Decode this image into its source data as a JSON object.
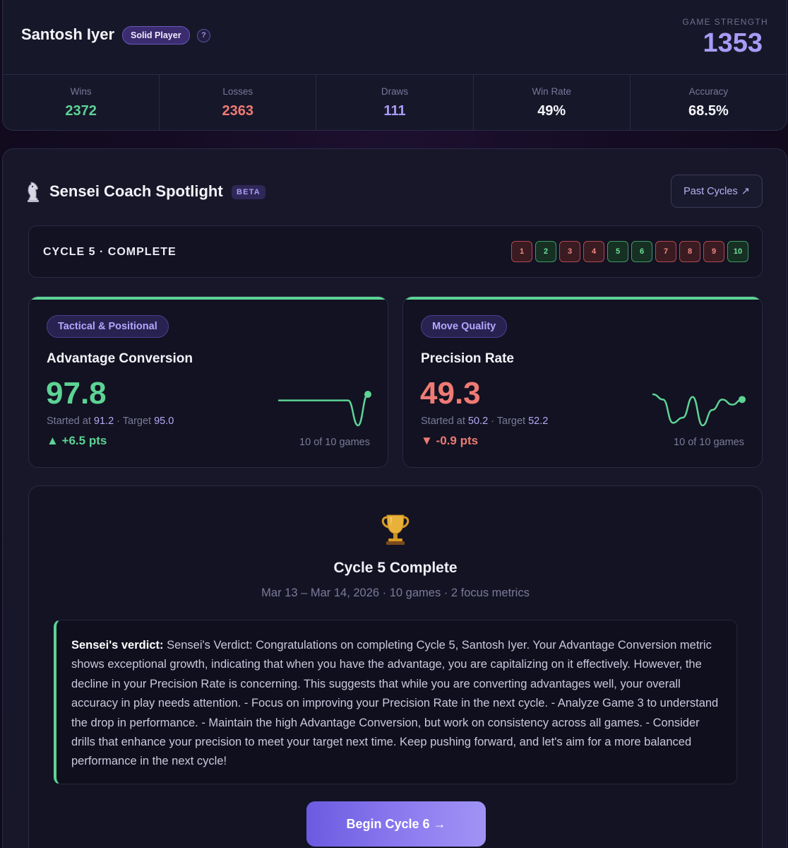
{
  "profile": {
    "name": "Santosh Iyer",
    "tier": "Solid Player",
    "help_glyph": "?",
    "strength_label": "GAME STRENGTH",
    "strength_value": "1353",
    "stats": [
      {
        "label": "Wins",
        "value": "2372",
        "color": "#5dd394"
      },
      {
        "label": "Losses",
        "value": "2363",
        "color": "#ef7b74"
      },
      {
        "label": "Draws",
        "value": "111",
        "color": "#a89bf7"
      },
      {
        "label": "Win Rate",
        "value": "49%",
        "color": "#f5f5fb"
      },
      {
        "label": "Accuracy",
        "value": "68.5%",
        "color": "#f5f5fb"
      }
    ]
  },
  "coach": {
    "title": "Sensei Coach Spotlight",
    "beta": "BETA",
    "past_cycles": "Past Cycles",
    "past_cycles_arrow": "↗",
    "cycle_label": "CYCLE 5 · COMPLETE",
    "games": [
      {
        "n": "1",
        "result": "loss"
      },
      {
        "n": "2",
        "result": "win"
      },
      {
        "n": "3",
        "result": "loss"
      },
      {
        "n": "4",
        "result": "loss"
      },
      {
        "n": "5",
        "result": "win"
      },
      {
        "n": "6",
        "result": "win"
      },
      {
        "n": "7",
        "result": "loss"
      },
      {
        "n": "8",
        "result": "loss"
      },
      {
        "n": "9",
        "result": "loss"
      },
      {
        "n": "10",
        "result": "win"
      }
    ],
    "metrics": [
      {
        "tag": "Tactical & Positional",
        "name": "Advantage Conversion",
        "value": "97.8",
        "value_color": "#5dd394",
        "started_label": "Started at",
        "started": "91.2",
        "target_label": "Target",
        "target": "95.0",
        "delta": "▲ +6.5 pts",
        "delta_color": "#5dd394",
        "games_note": "10 of 10 games",
        "trend": [
          95.5,
          95.5,
          95.5,
          95.5,
          95.5,
          95.5,
          95.5,
          95.5,
          86.0,
          97.8
        ]
      },
      {
        "tag": "Move Quality",
        "name": "Precision Rate",
        "value": "49.3",
        "value_color": "#ef7b74",
        "started_label": "Started at",
        "started": "50.2",
        "target_label": "Target",
        "target": "52.2",
        "delta": "▼ -0.9 pts",
        "delta_color": "#ef7b74",
        "games_note": "10 of 10 games",
        "trend": [
          49.8,
          49.6,
          48.7,
          48.9,
          49.7,
          48.6,
          49.2,
          49.6,
          49.4,
          49.6
        ]
      }
    ],
    "summary": {
      "trophy_icon": "trophy-icon",
      "title": "Cycle 5 Complete",
      "meta": "Mar 13 – Mar 14, 2026 · 10 games · 2 focus metrics",
      "verdict_label": "Sensei's verdict:",
      "verdict_text": "Sensei's Verdict: Congratulations on completing Cycle 5, Santosh Iyer. Your Advantage Conversion metric shows exceptional growth, indicating that when you have the advantage, you are capitalizing on it effectively. However, the decline in your Precision Rate is concerning. This suggests that while you are converting advantages well, your overall accuracy in play needs attention. - Focus on improving your Precision Rate in the next cycle. - Analyze Game 3 to understand the drop in performance. - Maintain the high Advantage Conversion, but work on consistency across all games. - Consider drills that enhance your precision to meet your target next time. Keep pushing forward, and let's aim for a more balanced performance in the next cycle!",
      "cta": "Begin Cycle 6 →"
    }
  }
}
